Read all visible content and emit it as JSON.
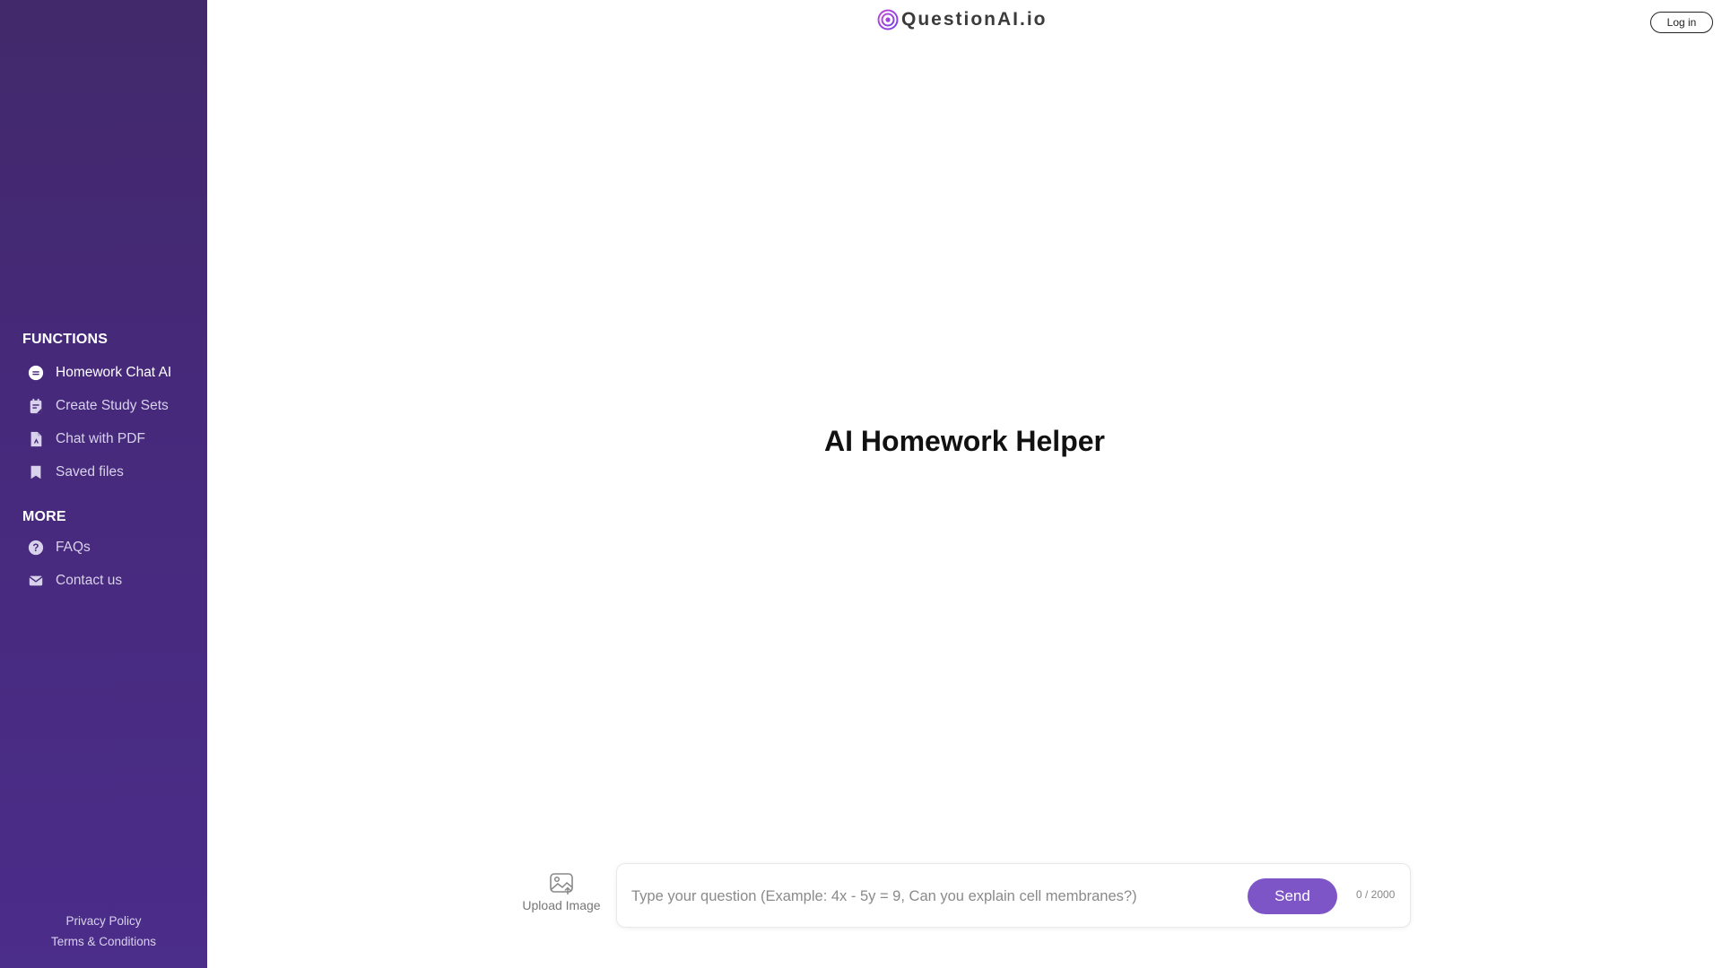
{
  "brand": {
    "name": "QuestionAI.io",
    "accent": "#7d55c7",
    "sidebar_bg": "#46297a"
  },
  "header": {
    "login_label": "Log in"
  },
  "sidebar": {
    "functions_title": "FUNCTIONS",
    "functions": [
      {
        "label": "Homework Chat AI",
        "icon": "chat-icon",
        "active": true
      },
      {
        "label": "Create Study Sets",
        "icon": "study-set-icon",
        "active": false
      },
      {
        "label": "Chat with PDF",
        "icon": "pdf-icon",
        "active": false
      },
      {
        "label": "Saved files",
        "icon": "bookmark-icon",
        "active": false
      }
    ],
    "more_title": "MORE",
    "more": [
      {
        "label": "FAQs",
        "icon": "question-icon"
      },
      {
        "label": "Contact us",
        "icon": "mail-icon"
      }
    ],
    "footer": {
      "privacy": "Privacy Policy",
      "terms": "Terms & Conditions"
    }
  },
  "main": {
    "title": "AI Homework Helper",
    "upload_label": "Upload Image",
    "input": {
      "value": "",
      "placeholder": "Type your question (Example: 4x - 5y = 9, Can you explain cell membranes?)"
    },
    "send_label": "Send",
    "char_counter": "0 / 2000"
  }
}
